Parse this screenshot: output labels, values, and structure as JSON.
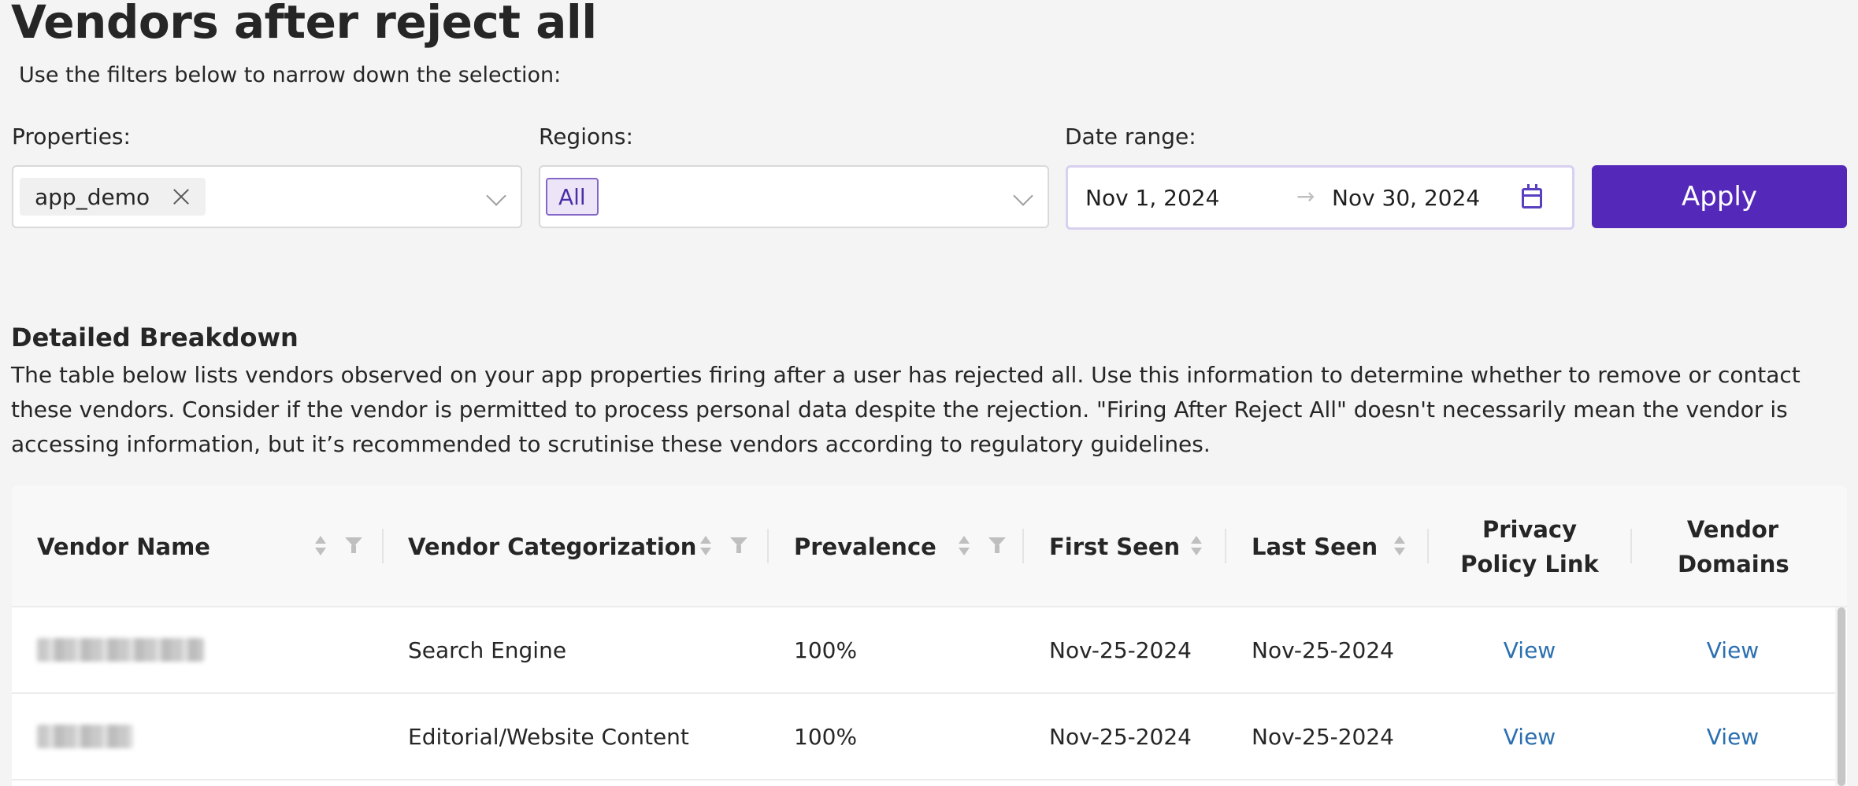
{
  "header": {
    "title": "Vendors after reject all",
    "subtitle": "Use the filters below to narrow down the selection:"
  },
  "filters": {
    "properties": {
      "label": "Properties:",
      "selected_tag": "app_demo"
    },
    "regions": {
      "label": "Regions:",
      "selected_tag": "All"
    },
    "date_range": {
      "label": "Date range:",
      "start": "Nov 1, 2024",
      "arrow": "→",
      "end": "Nov 30, 2024"
    },
    "apply_label": "Apply"
  },
  "breakdown": {
    "title": "Detailed Breakdown",
    "description": "The table below lists vendors observed on your app properties firing after a user has rejected all. Use this information to determine whether to remove or contact these vendors. Consider if the vendor is permitted to process personal data despite the rejection. \"Firing After Reject All\" doesn't necessarily mean the vendor is accessing information, but it’s recommended to scrutinise these vendors according to regulatory guidelines."
  },
  "table": {
    "columns": {
      "vendor_name": "Vendor Name",
      "vendor_categorization": "Vendor Categorization",
      "prevalence": "Prevalence",
      "first_seen": "First Seen",
      "last_seen": "Last Seen",
      "privacy_policy_link": "Privacy Policy Link",
      "vendor_domains": "Vendor Domains"
    },
    "rows": [
      {
        "categorization": "Search Engine",
        "prevalence": "100%",
        "first_seen": "Nov-25-2024",
        "last_seen": "Nov-25-2024",
        "privacy_link": "View",
        "domains_link": "View"
      },
      {
        "categorization": "Editorial/Website Content",
        "prevalence": "100%",
        "first_seen": "Nov-25-2024",
        "last_seen": "Nov-25-2024",
        "privacy_link": "View",
        "domains_link": "View"
      }
    ]
  },
  "colors": {
    "accent": "#5428b8",
    "link": "#2a6fb0",
    "tag_regions_bg": "#ece5f7"
  },
  "icons": {
    "tag_remove": "close-icon",
    "dropdown": "chevron-down-icon",
    "calendar": "calendar-icon",
    "sort": "sort-icon",
    "filter": "filter-icon"
  }
}
